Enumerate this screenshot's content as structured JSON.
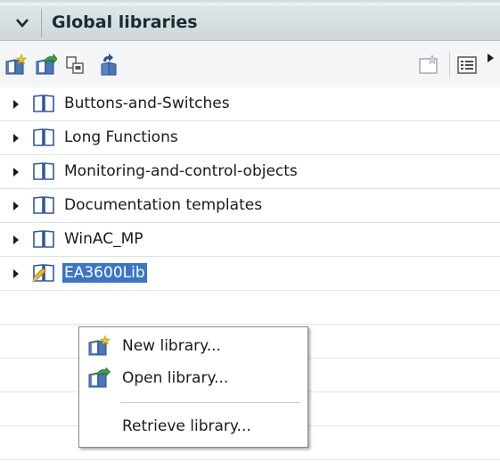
{
  "header": {
    "title": "Global libraries",
    "collapse_icon": "chevron-down-icon"
  },
  "toolbar": {
    "buttons": [
      {
        "name": "new-library-button",
        "icon": "new-library-icon"
      },
      {
        "name": "open-library-button",
        "icon": "open-library-icon"
      },
      {
        "name": "save-library-button",
        "icon": "save-library-icon"
      },
      {
        "name": "update-library-button",
        "icon": "update-library-icon"
      },
      {
        "name": "new-folder-button",
        "icon": "new-folder-icon"
      },
      {
        "name": "details-view-button",
        "icon": "details-view-icon"
      },
      {
        "name": "more-options-button",
        "icon": "triangle-right-icon"
      }
    ]
  },
  "tree": {
    "items": [
      {
        "label": "Buttons-and-Switches",
        "selected": false,
        "icon": "library-book-icon"
      },
      {
        "label": "Long Functions",
        "selected": false,
        "icon": "library-book-icon"
      },
      {
        "label": "Monitoring-and-control-objects",
        "selected": false,
        "icon": "library-book-icon"
      },
      {
        "label": "Documentation templates",
        "selected": false,
        "icon": "library-book-icon"
      },
      {
        "label": "WinAC_MP",
        "selected": false,
        "icon": "library-book-icon"
      },
      {
        "label": "EA3600Lib",
        "selected": true,
        "icon": "library-book-edit-icon"
      }
    ]
  },
  "context_menu": {
    "items": [
      {
        "label": "New library...",
        "icon": "new-library-icon"
      },
      {
        "label": "Open library...",
        "icon": "open-library-icon"
      },
      {
        "label": "Retrieve library...",
        "icon": ""
      }
    ]
  },
  "colors": {
    "selection": "#3b75c9",
    "header_bg": "#d6dfe2",
    "row_divider": "#dde3e5"
  }
}
